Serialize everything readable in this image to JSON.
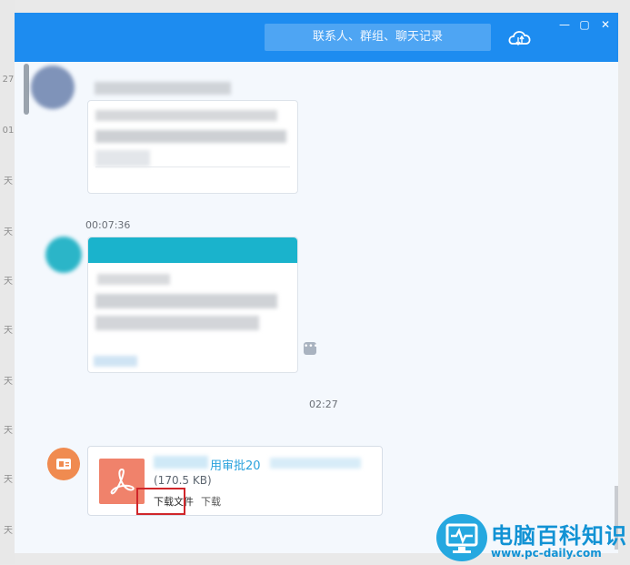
{
  "search": {
    "placeholder": "联系人、群组、聊天记录"
  },
  "left_strip": {
    "labels": [
      "27",
      "01",
      "天",
      "天",
      "天",
      "天",
      "天",
      "天",
      "天",
      "天",
      "天"
    ]
  },
  "messages": [
    {
      "time": ""
    },
    {
      "time": "00:07:36"
    },
    {
      "time": "02:27"
    }
  ],
  "file": {
    "name": "用审批20",
    "size": "(170.5 KB)",
    "download_file_label": "下载文件",
    "download_label": "下载"
  },
  "brand": {
    "title": "电脑百科知识",
    "url": "www.pc-daily.com"
  },
  "colors": {
    "titlebar": "#1d8cf0",
    "highlight": "#d0262a",
    "pdf": "#f0826b",
    "brand": "#1192d4"
  }
}
